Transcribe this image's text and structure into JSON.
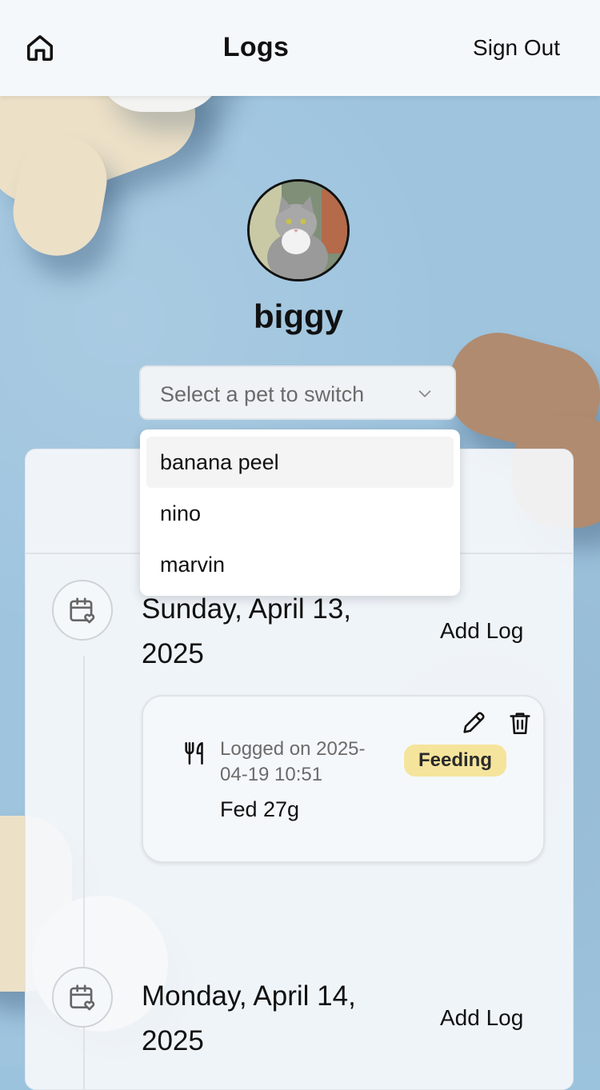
{
  "header": {
    "title": "Logs",
    "sign_out": "Sign Out",
    "home_icon": "home-icon"
  },
  "pet": {
    "name": "biggy"
  },
  "pet_switcher": {
    "placeholder": "Select a pet to switch",
    "options": [
      {
        "label": "banana peel",
        "highlighted": true
      },
      {
        "label": "nino",
        "highlighted": false
      },
      {
        "label": "marvin",
        "highlighted": false
      }
    ]
  },
  "days": [
    {
      "date": "Sunday, April 13, 2025",
      "add_log": "Add Log",
      "entries": [
        {
          "icon": "fork-knife-icon",
          "logged": "Logged on 2025-04-19 10:51",
          "tag": "Feeding",
          "description": "Fed 27g"
        }
      ]
    },
    {
      "date": "Monday, April 14, 2025",
      "add_log": "Add Log",
      "entries": []
    }
  ],
  "colors": {
    "badge_feeding": "#f5e49c",
    "header_bg": "#f5f8fb",
    "background": "#9ec4de"
  }
}
